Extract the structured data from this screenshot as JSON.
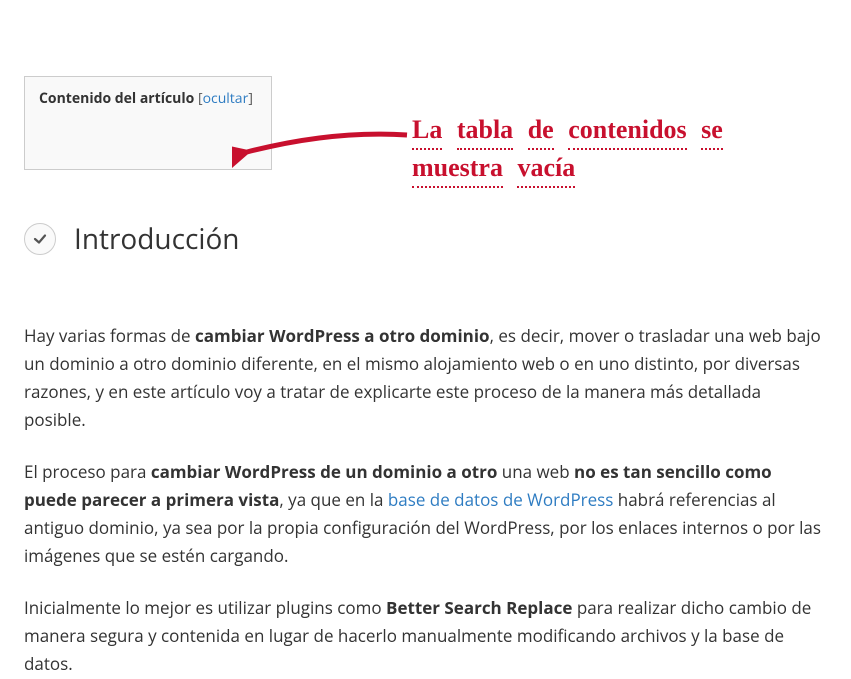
{
  "toc": {
    "title": "Contenido del artículo",
    "toggle_label": "ocultar"
  },
  "annotation": {
    "line1_words": [
      "La",
      "tabla",
      "de",
      "contenidos",
      "se"
    ],
    "line2_words": [
      "muestra",
      "vacía"
    ]
  },
  "section": {
    "heading": "Introducción"
  },
  "paragraphs": {
    "p1_pre": "Hay varias formas de ",
    "p1_b1": "cambiar WordPress a otro dominio",
    "p1_post": ", es decir, mover o trasladar una web bajo un dominio a otro dominio diferente, en el mismo alojamiento web o en uno distinto, por diversas razones, y en este artículo voy a tratar de explicarte este proceso de la manera más detallada posible.",
    "p2_a": "El proceso para ",
    "p2_b1": "cambiar WordPress de un dominio a otro",
    "p2_b": " una web ",
    "p2_b2": "no es tan sencillo como puede parecer a primera vista",
    "p2_c": ", ya que en la ",
    "p2_link": "base de datos de WordPress",
    "p2_d": " habrá referencias al antiguo dominio, ya sea por la propia configuración del WordPress, por los enlaces internos o por las imágenes que se estén cargando.",
    "p3_a": "Inicialmente lo mejor es utilizar plugins como ",
    "p3_b1": "Better Search Replace",
    "p3_b": " para realizar dicho cambio de manera segura y contenida en lugar de hacerlo manualmente modificando archivos y la base de datos."
  }
}
